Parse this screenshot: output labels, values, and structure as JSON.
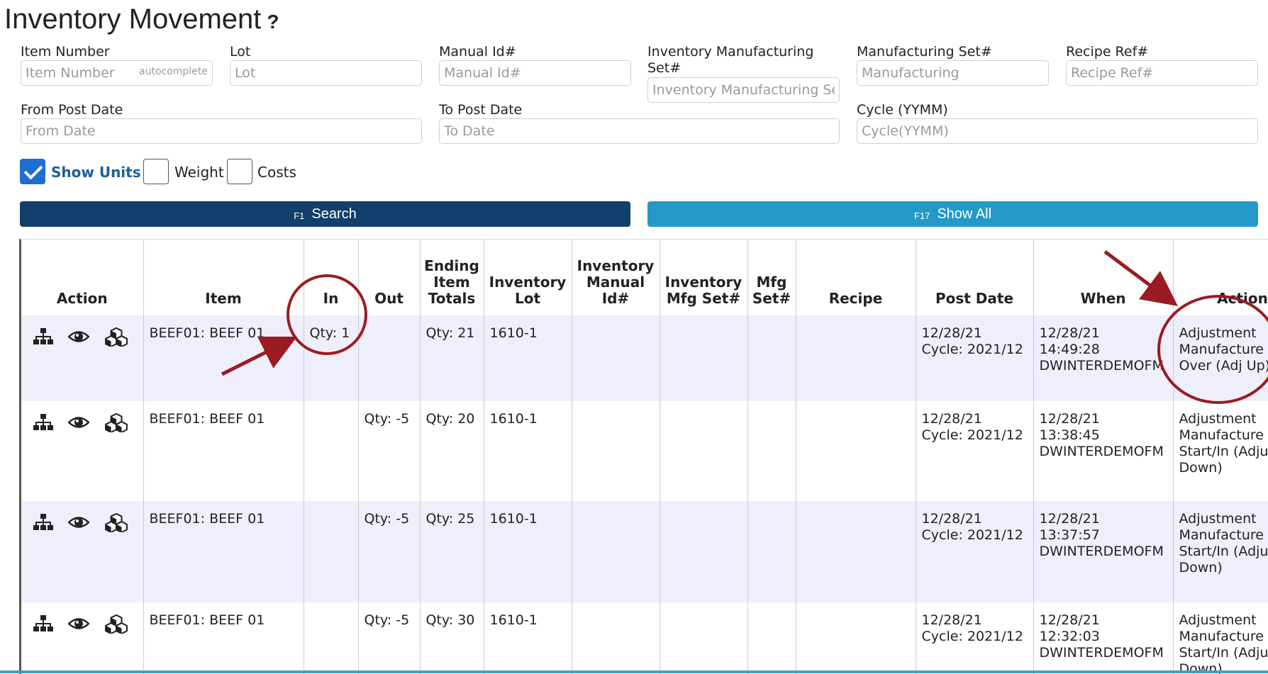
{
  "page": {
    "title": "Inventory Movement",
    "help_icon": "?"
  },
  "filters": {
    "item_number": {
      "label": "Item Number",
      "placeholder": "Item Number",
      "hint": "autocomplete"
    },
    "lot": {
      "label": "Lot",
      "placeholder": "Lot"
    },
    "manual_id": {
      "label": "Manual Id#",
      "placeholder": "Manual Id#"
    },
    "inv_mfg_set": {
      "label_line1": "Inventory Manufacturing",
      "label_line2": "Set#",
      "placeholder": "Inventory Manufacturing Set#"
    },
    "mfg_set": {
      "label": "Manufacturing Set#",
      "placeholder": "Manufacturing"
    },
    "recipe_ref": {
      "label": "Recipe Ref#",
      "placeholder": "Recipe Ref#"
    },
    "from_post_date": {
      "label": "From Post Date",
      "placeholder": "From Date"
    },
    "to_post_date": {
      "label": "To Post Date",
      "placeholder": "To Date"
    },
    "cycle": {
      "label": "Cycle (YYMM)",
      "placeholder": "Cycle(YYMM)"
    }
  },
  "options": {
    "show_units": {
      "label": "Show Units",
      "checked": true
    },
    "weight": {
      "label": "Weight",
      "checked": false
    },
    "costs": {
      "label": "Costs",
      "checked": false
    }
  },
  "buttons": {
    "search": {
      "fkey": "F1",
      "label": "Search"
    },
    "show_all": {
      "fkey": "F17",
      "label": "Show All"
    }
  },
  "table": {
    "headers": {
      "action": "Action",
      "item": "Item",
      "in": "In",
      "out": "Out",
      "ending_1": "Ending",
      "ending_2": "Item",
      "ending_3": "Totals",
      "inv_lot_1": "Inventory",
      "inv_lot_2": "Lot",
      "inv_manual_1": "Inventory",
      "inv_manual_2": "Manual",
      "inv_manual_3": "Id#",
      "inv_mfg_1": "Inventory",
      "inv_mfg_2": "Mfg Set#",
      "mfg_set_1": "Mfg",
      "mfg_set_2": "Set#",
      "recipe": "Recipe",
      "post_date": "Post Date",
      "when": "When",
      "action2": "Action"
    },
    "rows": [
      {
        "item": "BEEF01: BEEF 01",
        "in": "Qty: 1",
        "out": "",
        "ending": "Qty: 21",
        "lot": "1610-1",
        "post_date": "12/28/21",
        "cycle": "Cycle: 2021/12",
        "when_date": "12/28/21",
        "when_time": "14:49:28",
        "when_user": "DWINTERDEMOFM",
        "action_text": "Adjustment Manufacture Left Over (Adj Up)"
      },
      {
        "item": "BEEF01: BEEF 01",
        "in": "",
        "out": "Qty: -5",
        "ending": "Qty: 20",
        "lot": "1610-1",
        "post_date": "12/28/21",
        "cycle": "Cycle: 2021/12",
        "when_date": "12/28/21",
        "when_time": "13:38:45",
        "when_user": "DWINTERDEMOFM",
        "action_text": "Adjustment Manufacture Start/In (Adjust Down)"
      },
      {
        "item": "BEEF01: BEEF 01",
        "in": "",
        "out": "Qty: -5",
        "ending": "Qty: 25",
        "lot": "1610-1",
        "post_date": "12/28/21",
        "cycle": "Cycle: 2021/12",
        "when_date": "12/28/21",
        "when_time": "13:37:57",
        "when_user": "DWINTERDEMOFM",
        "action_text": "Adjustment Manufacture Start/In (Adjust Down)"
      },
      {
        "item": "BEEF01: BEEF 01",
        "in": "",
        "out": "Qty: -5",
        "ending": "Qty: 30",
        "lot": "1610-1",
        "post_date": "12/28/21",
        "cycle": "Cycle: 2021/12",
        "when_date": "12/28/21",
        "when_time": "12:32:03",
        "when_user": "DWINTERDEMOFM",
        "action_text": "Adjustment Manufacture Start/In (Adjust Down)"
      }
    ]
  },
  "annotation_colors": {
    "accent": "#9b1b22"
  }
}
